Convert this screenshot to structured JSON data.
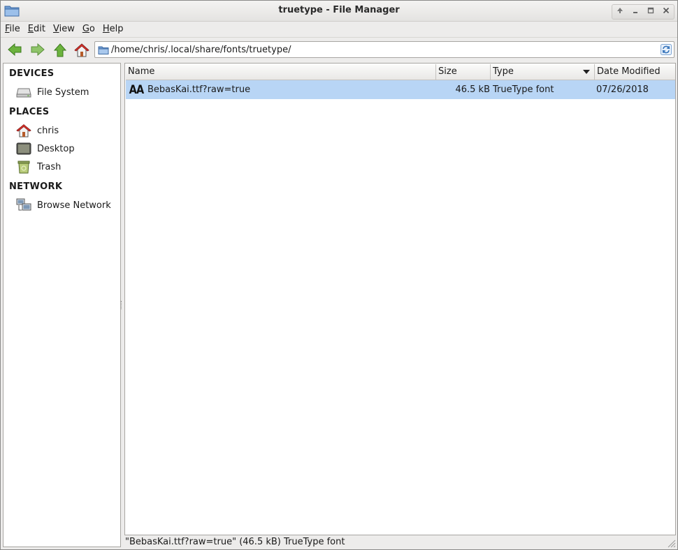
{
  "window": {
    "title": "truetype - File Manager",
    "controls": [
      "up-icon",
      "minimize-icon",
      "maximize-icon",
      "close-icon"
    ]
  },
  "menu": {
    "file": {
      "mnemonic": "F",
      "rest": "ile"
    },
    "edit": {
      "mnemonic": "E",
      "rest": "dit"
    },
    "view": {
      "mnemonic": "V",
      "rest": "iew"
    },
    "go": {
      "mnemonic": "G",
      "rest": "o"
    },
    "help": {
      "mnemonic": "H",
      "rest": "elp"
    }
  },
  "toolbar": {
    "buttons": [
      "back-icon",
      "forward-icon",
      "parent-folder-icon",
      "home-icon"
    ],
    "location": "/home/chris/.local/share/fonts/truetype/"
  },
  "sidebar": {
    "devices_header": "DEVICES",
    "places_header": "PLACES",
    "network_header": "NETWORK",
    "devices": [
      {
        "label": "File System",
        "icon": "drive-icon"
      }
    ],
    "places": [
      {
        "label": "chris",
        "icon": "home-folder-icon"
      },
      {
        "label": "Desktop",
        "icon": "desktop-icon"
      },
      {
        "label": "Trash",
        "icon": "trash-icon"
      }
    ],
    "network": [
      {
        "label": "Browse Network",
        "icon": "network-icon"
      }
    ]
  },
  "columns": {
    "name": "Name",
    "size": "Size",
    "type": "Type",
    "date": "Date Modified"
  },
  "files": [
    {
      "name": "BebasKai.ttf?raw=true",
      "size": "46.5 kB",
      "type": "TrueType font",
      "date": "07/26/2018",
      "icon_text": "AA",
      "selected": true
    }
  ],
  "status": "\"BebasKai.ttf?raw=true\" (46.5 kB) TrueType font",
  "colors": {
    "selection": "#b8d5f5",
    "window_bg": "#edeceb"
  }
}
